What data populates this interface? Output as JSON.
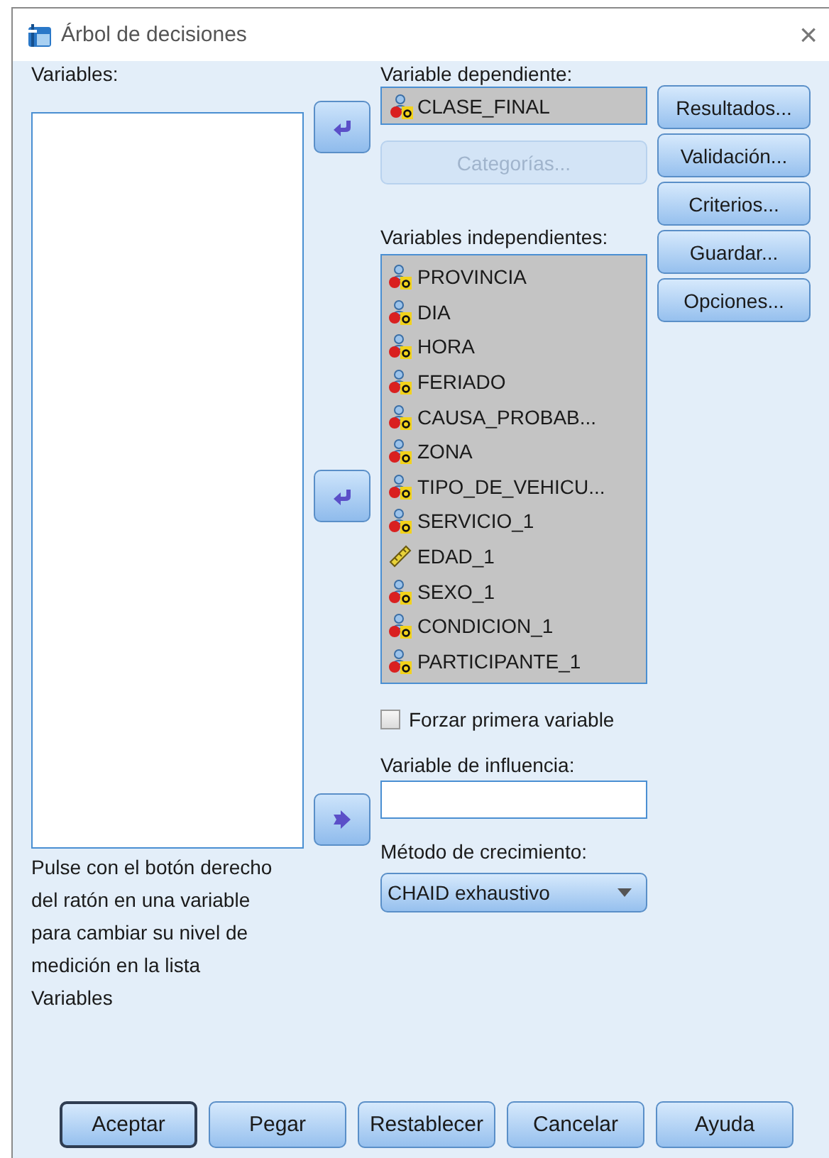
{
  "window": {
    "title": "Árbol de decisiones",
    "close": "×"
  },
  "variables": {
    "label": "Variables:"
  },
  "dependent": {
    "label": "Variable dependiente:",
    "value": {
      "name": "CLASE_FINAL",
      "kind": "nominal"
    },
    "categories_button": {
      "label": "Categorías...",
      "disabled": true
    }
  },
  "independent": {
    "label": "Variables independientes:",
    "items": [
      {
        "name": "PROVINCIA",
        "kind": "nominal"
      },
      {
        "name": "DIA",
        "kind": "nominal"
      },
      {
        "name": "HORA",
        "kind": "nominal"
      },
      {
        "name": "FERIADO",
        "kind": "nominal"
      },
      {
        "name": "CAUSA_PROBAB...",
        "kind": "nominal"
      },
      {
        "name": "ZONA",
        "kind": "nominal"
      },
      {
        "name": "TIPO_DE_VEHICU...",
        "kind": "nominal"
      },
      {
        "name": "SERVICIO_1",
        "kind": "nominal"
      },
      {
        "name": "EDAD_1",
        "kind": "scale"
      },
      {
        "name": "SEXO_1",
        "kind": "nominal"
      },
      {
        "name": "CONDICION_1",
        "kind": "nominal"
      },
      {
        "name": "PARTICIPANTE_1",
        "kind": "nominal"
      }
    ]
  },
  "arrows": [
    {
      "kind": "left"
    },
    {
      "kind": "left"
    },
    {
      "kind": "right"
    }
  ],
  "force_first": {
    "label": "Forzar primera variable",
    "checked": false
  },
  "influence": {
    "label": "Variable de influencia:"
  },
  "growth_method": {
    "label": "Método de crecimiento:",
    "value": "CHAID exhaustivo"
  },
  "help_text": "Pulse con el botón derecho del ratón en una variable para cambiar su nivel de medición en la lista Variables",
  "side_buttons": [
    "Resultados...",
    "Validación...",
    "Criterios...",
    "Guardar...",
    "Opciones..."
  ],
  "bottom_buttons": [
    {
      "label": "Aceptar",
      "default": true
    },
    {
      "label": "Pegar",
      "default": false
    },
    {
      "label": "Restablecer",
      "default": false
    },
    {
      "label": "Cancelar",
      "default": false
    },
    {
      "label": "Ayuda",
      "default": false
    }
  ]
}
